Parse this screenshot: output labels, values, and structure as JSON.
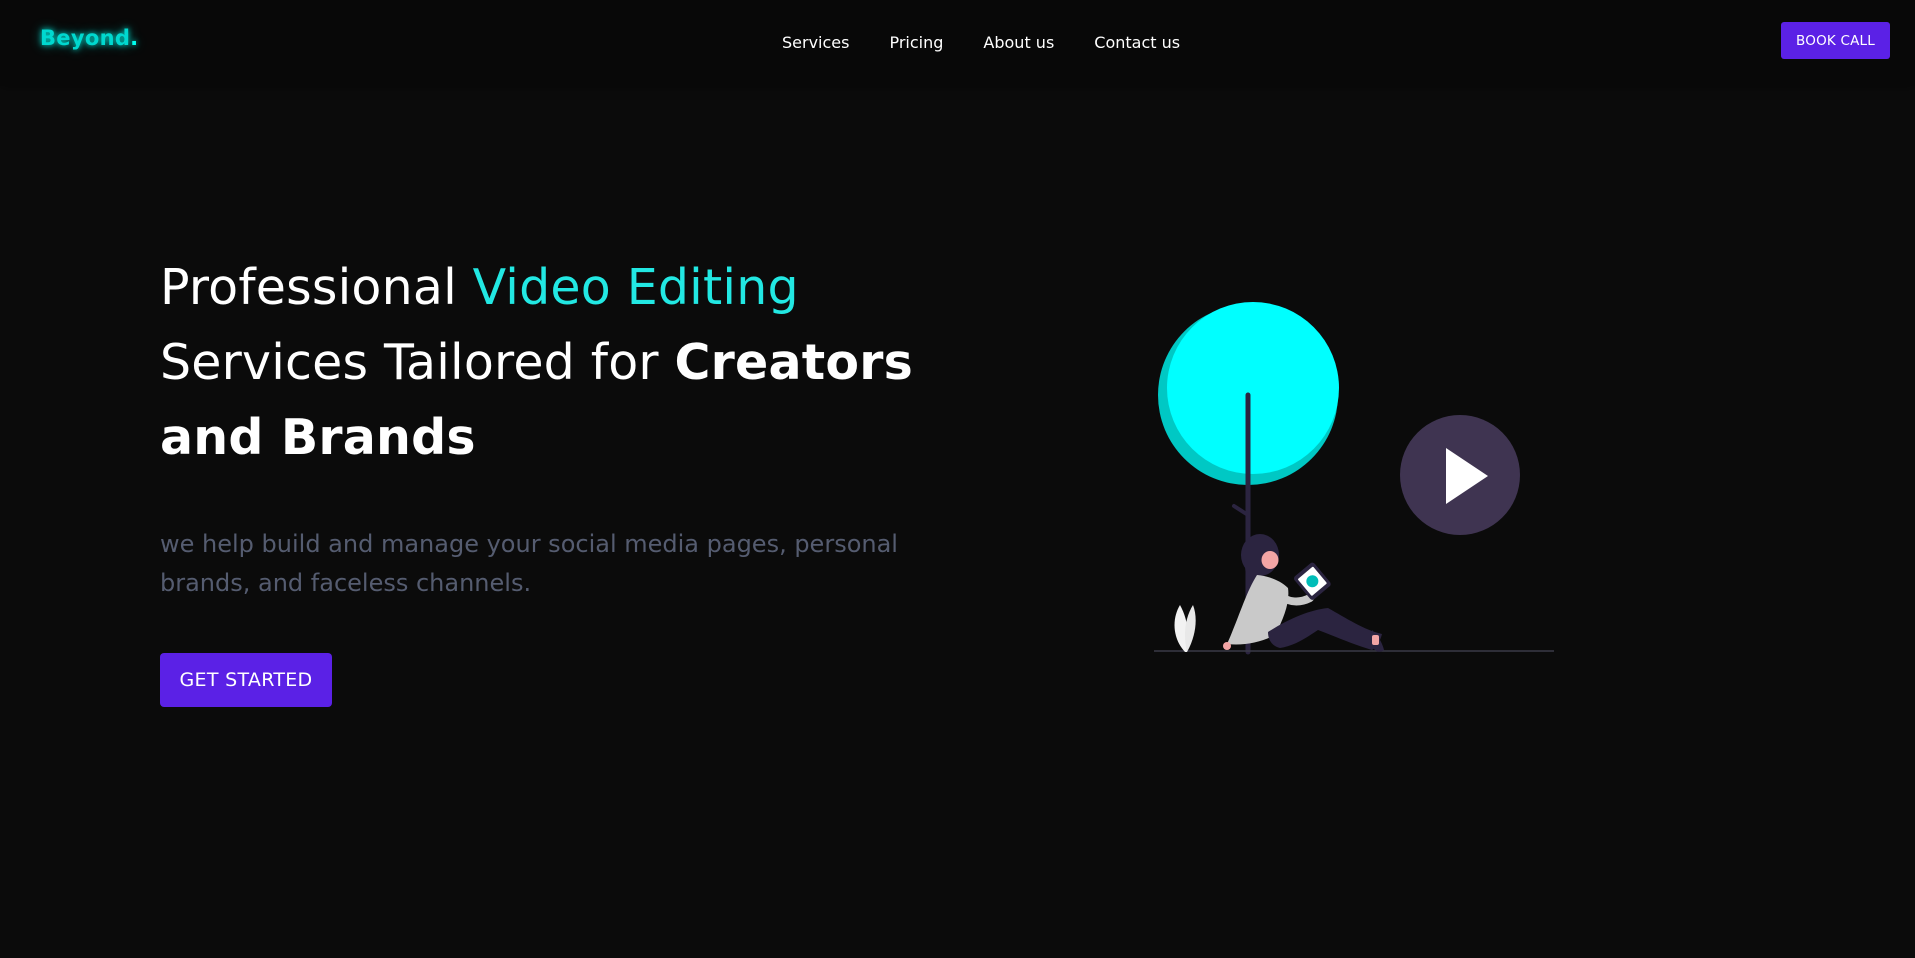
{
  "navbar": {
    "logo_text": "Beyond",
    "logo_dot": ".",
    "links": [
      "Services",
      "Pricing",
      "About us",
      "Contact us"
    ],
    "cta_label": "BOOK CALL"
  },
  "hero": {
    "title_part1": "Professional ",
    "title_accent": "Video Editing",
    "title_part2": "Services Tailored for ",
    "title_bold": "Creators and Brands",
    "subtitle": "we help build and manage your social media pages, personal brands, and faceless channels.",
    "cta_label": "GET STARTED"
  },
  "colors": {
    "background": "#0b0b0b",
    "navbar": "#080808",
    "accent_cyan": "#22e8e3",
    "brand_purple": "#5b21e6",
    "subtitle_gray": "#555c70"
  },
  "icons": {
    "play": "play-icon"
  }
}
